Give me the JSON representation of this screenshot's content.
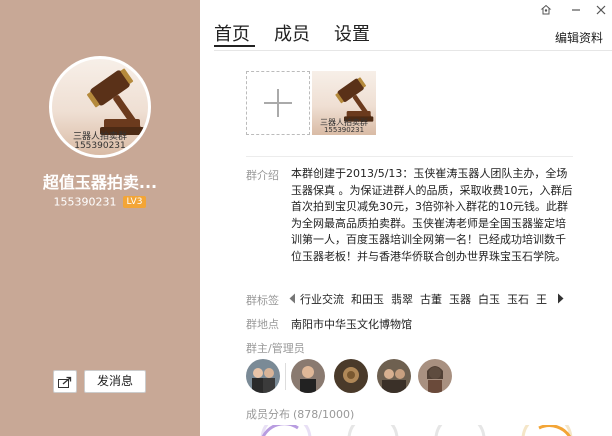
{
  "group": {
    "name": "超值玉器拍卖...",
    "id": "155390231",
    "level": "LV3",
    "avatar_caption_line1": "三器人拍卖群",
    "avatar_caption_line2": "155390231"
  },
  "actions": {
    "share_icon": "share-icon",
    "send_message_label": "发消息",
    "edit_label": "编辑资料"
  },
  "window_controls": [
    "skin-icon",
    "minimize-icon",
    "close-icon"
  ],
  "tabs": [
    {
      "label": "首页",
      "active": true
    },
    {
      "label": "成员",
      "active": false
    },
    {
      "label": "设置",
      "active": false
    }
  ],
  "photos": {
    "add_icon": "plus-icon",
    "thumb_caption_line1": "三器人拍卖群",
    "thumb_caption_line2": "155390231"
  },
  "intro": {
    "label": "群介绍",
    "text": "本群创建于2013/5/13：玉侠崔涛玉器人团队主办，全场玉器保真 。为保证进群人的品质，采取收费10元，入群后首次拍到宝贝减免30元，3倍弥补入群花的10元钱。此群为全网最高品质拍卖群。玉侠崔涛老师是全国玉器鉴定培训第一人，百度玉器培训全网第一名！已经成功培训数千位玉器老板！并与香港华侨联合创办世界珠宝玉石学院。"
  },
  "tags": {
    "label": "群标签",
    "items": [
      "行业交流",
      "和田玉",
      "翡翠",
      "古董",
      "玉器",
      "白玉",
      "玉石",
      "王"
    ]
  },
  "location": {
    "label": "群地点",
    "text": "南阳市中华玉文化博物馆"
  },
  "admins": {
    "label": "群主/管理员",
    "count": 5
  },
  "distribution": {
    "label": "成员分布",
    "count": "(878/1000)"
  },
  "colors": {
    "left_panel": "#c8a896",
    "level_badge": "#f3a536",
    "text_muted": "#999999"
  }
}
